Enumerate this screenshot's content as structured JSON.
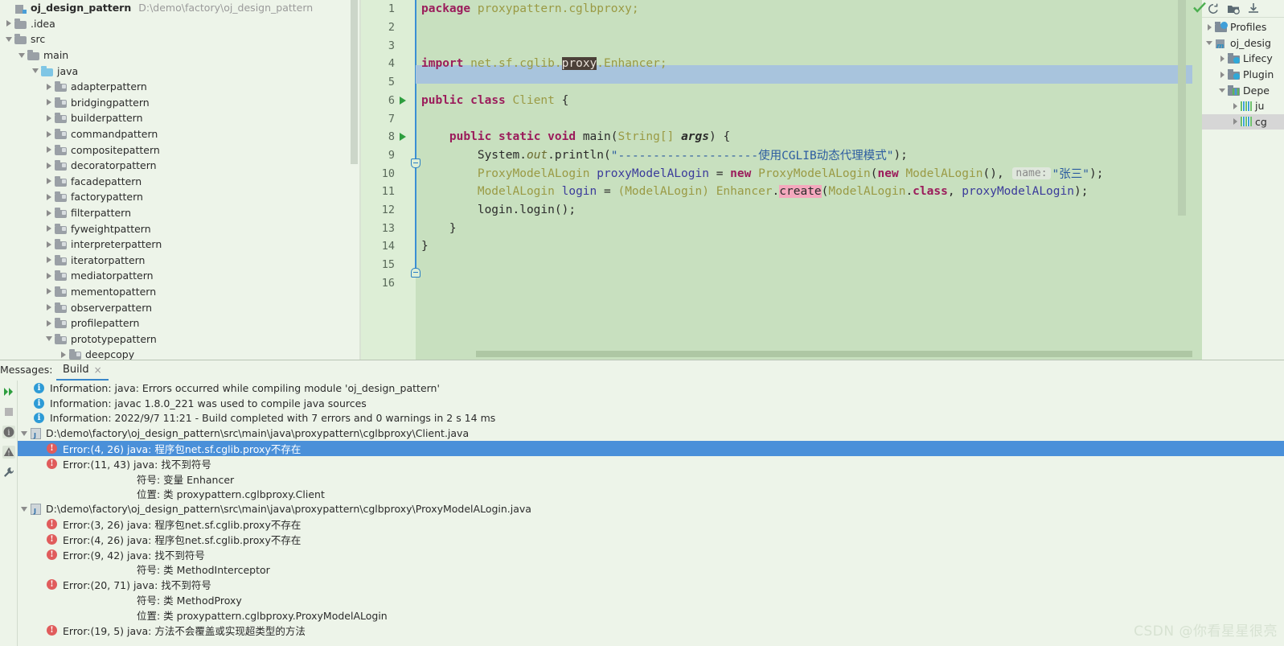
{
  "project": {
    "root": {
      "label": "oj_design_pattern",
      "path": "D:\\demo\\factory\\oj_design_pattern"
    },
    "items": [
      {
        "label": ".idea",
        "indent": 1,
        "state": "collapsed",
        "icon": "folder-icon"
      },
      {
        "label": "src",
        "indent": 1,
        "state": "expanded",
        "icon": "folder-icon"
      },
      {
        "label": "main",
        "indent": 2,
        "state": "expanded",
        "icon": "folder-icon"
      },
      {
        "label": "java",
        "indent": 3,
        "state": "expanded",
        "icon": "source-folder-icon"
      },
      {
        "label": "adapterpattern",
        "indent": 4,
        "state": "collapsed",
        "icon": "package-icon"
      },
      {
        "label": "bridgingpattern",
        "indent": 4,
        "state": "collapsed",
        "icon": "package-icon"
      },
      {
        "label": "builderpattern",
        "indent": 4,
        "state": "collapsed",
        "icon": "package-icon"
      },
      {
        "label": "commandpattern",
        "indent": 4,
        "state": "collapsed",
        "icon": "package-icon"
      },
      {
        "label": "compositepattern",
        "indent": 4,
        "state": "collapsed",
        "icon": "package-icon"
      },
      {
        "label": "decoratorpattern",
        "indent": 4,
        "state": "collapsed",
        "icon": "package-icon"
      },
      {
        "label": "facadepattern",
        "indent": 4,
        "state": "collapsed",
        "icon": "package-icon"
      },
      {
        "label": "factorypattern",
        "indent": 4,
        "state": "collapsed",
        "icon": "package-icon"
      },
      {
        "label": "filterpattern",
        "indent": 4,
        "state": "collapsed",
        "icon": "package-icon"
      },
      {
        "label": "fyweightpattern",
        "indent": 4,
        "state": "collapsed",
        "icon": "package-icon"
      },
      {
        "label": "interpreterpattern",
        "indent": 4,
        "state": "collapsed",
        "icon": "package-icon"
      },
      {
        "label": "iteratorpattern",
        "indent": 4,
        "state": "collapsed",
        "icon": "package-icon"
      },
      {
        "label": "mediatorpattern",
        "indent": 4,
        "state": "collapsed",
        "icon": "package-icon"
      },
      {
        "label": "mementopattern",
        "indent": 4,
        "state": "collapsed",
        "icon": "package-icon"
      },
      {
        "label": "observerpattern",
        "indent": 4,
        "state": "collapsed",
        "icon": "package-icon"
      },
      {
        "label": "profilepattern",
        "indent": 4,
        "state": "collapsed",
        "icon": "package-icon"
      },
      {
        "label": "prototypepattern",
        "indent": 4,
        "state": "expanded",
        "icon": "package-icon"
      },
      {
        "label": "deepcopy",
        "indent": 5,
        "state": "collapsed",
        "icon": "package-icon"
      }
    ]
  },
  "editor": {
    "line_numbers": [
      "1",
      "2",
      "3",
      "4",
      "5",
      "6",
      "7",
      "8",
      "9",
      "10",
      "11",
      "12",
      "13",
      "14",
      "15",
      "16"
    ],
    "current_line": 4,
    "code_lines": [
      "package proxypattern.cglbproxy;",
      "",
      "",
      "import net.sf.cglib.proxy.Enhancer;",
      "",
      "public class Client {",
      "",
      "    public static void main(String[] args) {",
      "        System.out.println(\"--------------------使用CGLIB动态代理模式\");",
      "        ProxyModelALogin proxyModelALogin = new ProxyModelALogin(new ModelALogin(),  name: \"张三\");",
      "        ModelALogin login = (ModelALogin) Enhancer.create(ModelALogin.class, proxyModelALogin);",
      "        login.login();",
      "    }",
      "}",
      "",
      ""
    ],
    "tokens": {
      "kw_package": "package",
      "pkg_name": "proxypattern.cglbproxy;",
      "kw_import": "import",
      "import_pre": "net.sf.cglib.",
      "import_selected": "proxy",
      "import_post": ".Enhancer;",
      "kw_public": "public",
      "kw_class": "class",
      "class_name": "Client",
      "brace_open": "{",
      "kw_static": "static",
      "kw_void": "void",
      "method_main": "main",
      "type_string": "String[]",
      "param_args": "args",
      "paren_brace": ") {",
      "paren_open": "(",
      "system": "System",
      "dot": ".",
      "out": "out",
      "println": "println",
      "println_str": "\"--------------------使用CGLIB动态代理模式\"",
      "println_end": ");",
      "type_proxy": "ProxyModelALogin",
      "var_proxy": "proxyModelALogin",
      "eq": "=",
      "kw_new": "new",
      "type_modela": "ModelALogin",
      "hint_name": "name:",
      "str_zhangsan": "\"张三\"",
      "close_paren_semi": ");",
      "var_login": "login",
      "cast_modela": "(ModelALogin)",
      "enhancer": "Enhancer",
      "create_err": "create",
      "modela_class": "ModelALogin",
      "kw_class_lit": "class",
      "login_login": "login.login();",
      "brace_close": "}"
    }
  },
  "maven": {
    "toolbar_icons": [
      "refresh-icon",
      "add-maven-project-icon",
      "download-sources-icon"
    ],
    "items": [
      {
        "label": "Profiles",
        "indent": 0,
        "state": "collapsed",
        "icon": "profiles-folder-icon",
        "selected": false
      },
      {
        "label": "oj_desig",
        "indent": 0,
        "state": "expanded",
        "icon": "maven-module-icon",
        "selected": false
      },
      {
        "label": "Lifecy",
        "indent": 1,
        "state": "collapsed",
        "icon": "lifecycle-folder-icon",
        "selected": false
      },
      {
        "label": "Plugin",
        "indent": 1,
        "state": "collapsed",
        "icon": "plugins-folder-icon",
        "selected": false
      },
      {
        "label": "Depe",
        "indent": 1,
        "state": "expanded",
        "icon": "dependencies-folder-icon",
        "selected": false
      },
      {
        "label": "ju",
        "indent": 2,
        "state": "collapsed",
        "icon": "jar-icon",
        "selected": false
      },
      {
        "label": "cg",
        "indent": 2,
        "state": "collapsed",
        "icon": "jar-icon",
        "selected": true
      }
    ]
  },
  "messages": {
    "label": "Messages:",
    "tab": {
      "name": "Build",
      "close": "×"
    },
    "toolbar_icons": [
      "rerun-icon",
      "stop-icon",
      "info-filter-icon",
      "warning-filter-icon",
      "settings-icon"
    ],
    "rows": [
      {
        "kind": "info",
        "indent": 1,
        "text": "Information: java: Errors occurred while compiling module 'oj_design_pattern'",
        "selected": false
      },
      {
        "kind": "info",
        "indent": 1,
        "text": "Information: javac 1.8.0_221 was used to compile java sources",
        "selected": false
      },
      {
        "kind": "info",
        "indent": 1,
        "text": "Information: 2022/9/7 11:21 - Build completed with 7 errors and 0 warnings in 2 s 14 ms",
        "selected": false
      },
      {
        "kind": "file",
        "indent": 0,
        "text": "D:\\demo\\factory\\oj_design_pattern\\src\\main\\java\\proxypattern\\cglbproxy\\Client.java",
        "selected": false
      },
      {
        "kind": "error",
        "indent": 2,
        "text": "Error:(4, 26)  java: 程序包net.sf.cglib.proxy不存在",
        "selected": true
      },
      {
        "kind": "error",
        "indent": 2,
        "text": "Error:(11, 43)  java: 找不到符号",
        "selected": false
      },
      {
        "kind": "plain",
        "indent": 9,
        "text": "符号:   变量 Enhancer",
        "selected": false
      },
      {
        "kind": "plain",
        "indent": 9,
        "text": "位置: 类 proxypattern.cglbproxy.Client",
        "selected": false
      },
      {
        "kind": "file",
        "indent": 0,
        "text": "D:\\demo\\factory\\oj_design_pattern\\src\\main\\java\\proxypattern\\cglbproxy\\ProxyModelALogin.java",
        "selected": false
      },
      {
        "kind": "error",
        "indent": 2,
        "text": "Error:(3, 26)  java: 程序包net.sf.cglib.proxy不存在",
        "selected": false
      },
      {
        "kind": "error",
        "indent": 2,
        "text": "Error:(4, 26)  java: 程序包net.sf.cglib.proxy不存在",
        "selected": false
      },
      {
        "kind": "error",
        "indent": 2,
        "text": "Error:(9, 42)  java: 找不到符号",
        "selected": false
      },
      {
        "kind": "plain",
        "indent": 9,
        "text": "符号: 类 MethodInterceptor",
        "selected": false
      },
      {
        "kind": "error",
        "indent": 2,
        "text": "Error:(20, 71)  java: 找不到符号",
        "selected": false
      },
      {
        "kind": "plain",
        "indent": 9,
        "text": "符号:  类 MethodProxy",
        "selected": false
      },
      {
        "kind": "plain",
        "indent": 9,
        "text": "位置: 类 proxypattern.cglbproxy.ProxyModelALogin",
        "selected": false
      },
      {
        "kind": "error",
        "indent": 2,
        "text": "Error:(19, 5)  java: 方法不会覆盖或实现超类型的方法",
        "selected": false
      }
    ]
  },
  "watermark": "CSDN @你看星星很亮",
  "colors": {
    "editor_bg": "#c8e0bf",
    "gutter_bg": "#ddeed6",
    "panel_bg": "#edf4e9",
    "current_line": "#a8c4dd",
    "selection_blue": "#4a90d9",
    "error_red": "#e05c5c",
    "info_blue": "#2d9bd6",
    "keyword": "#9b1c5b",
    "error_highlight": "#f4a8bd",
    "word_selection": "#4b4038"
  }
}
